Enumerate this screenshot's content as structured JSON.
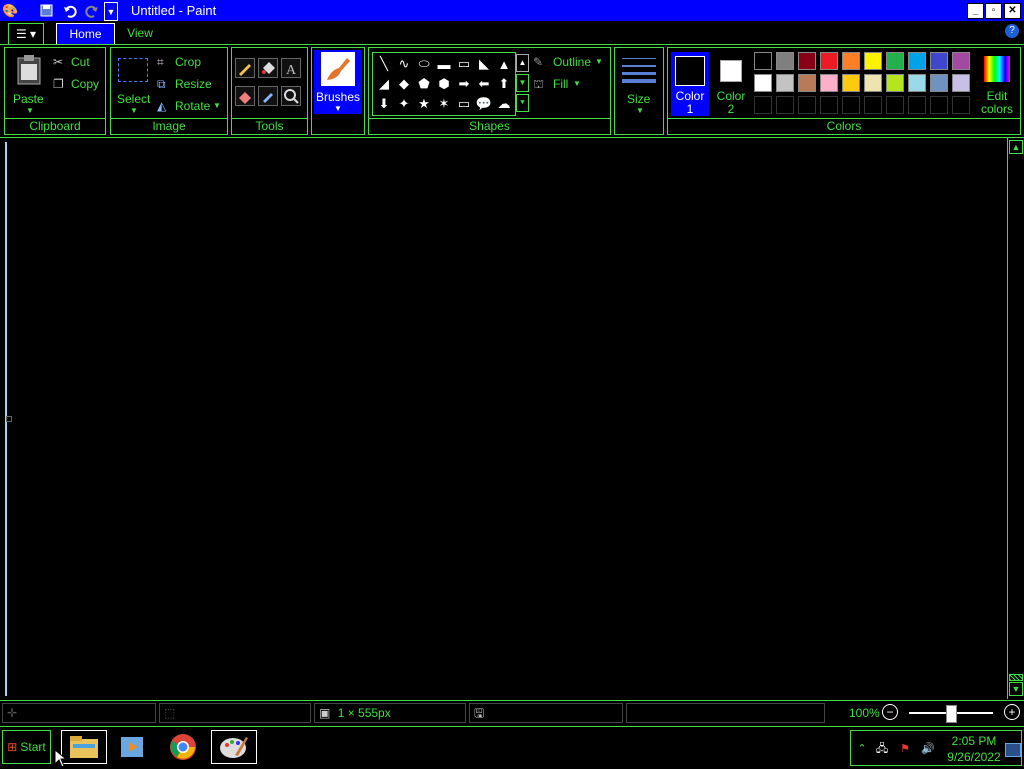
{
  "window": {
    "title": "Untitled - Paint"
  },
  "quick_access": [
    "paint-app-icon",
    "save-icon",
    "undo-icon",
    "redo-icon",
    "customize-quick-access-icon"
  ],
  "tabs": {
    "file_menu_icon": "file-menu-icon",
    "home": "Home",
    "view": "View"
  },
  "ribbon": {
    "clipboard": {
      "label": "Clipboard",
      "paste": "Paste",
      "cut": "Cut",
      "copy": "Copy"
    },
    "image": {
      "label": "Image",
      "select": "Select",
      "crop": "Crop",
      "resize": "Resize",
      "rotate": "Rotate"
    },
    "tools": {
      "label": "Tools"
    },
    "brushes": {
      "label": "Brushes"
    },
    "shapes": {
      "label": "Shapes",
      "outline": "Outline",
      "fill": "Fill"
    },
    "size": {
      "label": "Size"
    },
    "colors": {
      "label": "Colors",
      "color1": "Color 1",
      "color2": "Color 2",
      "edit": "Edit colors",
      "row1": [
        "#000000",
        "#7f7f7f",
        "#880015",
        "#ed1c24",
        "#ff7f27",
        "#fff200",
        "#22b14c",
        "#00a2e8",
        "#3f48cc",
        "#a349a4"
      ],
      "row2": [
        "#ffffff",
        "#c3c3c3",
        "#b97a57",
        "#ffaec9",
        "#ffc90e",
        "#efe4b0",
        "#b5e61d",
        "#99d9ea",
        "#7092be",
        "#c8bfe7"
      ]
    }
  },
  "status": {
    "selection_size": "1 × 555px",
    "zoom": "100%"
  },
  "taskbar": {
    "start": "Start",
    "time": "2:05 PM",
    "date": "9/26/2022"
  }
}
